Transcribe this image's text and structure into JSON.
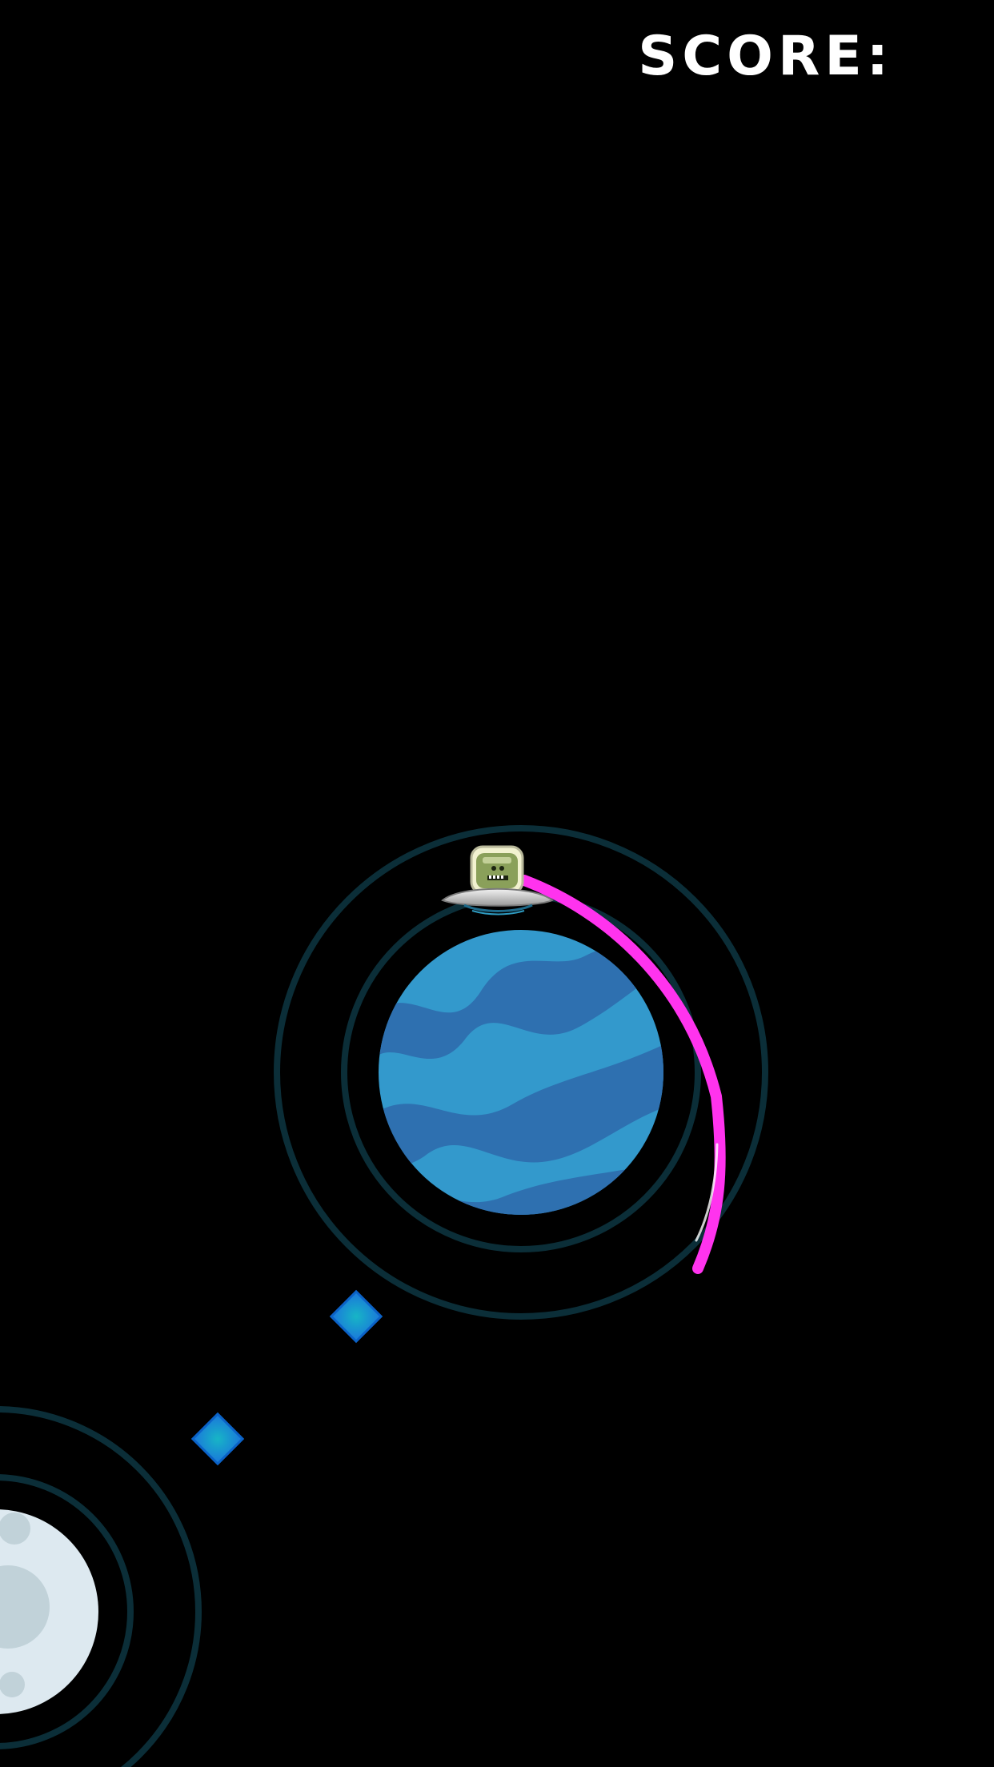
{
  "hud": {
    "score_label": "SCORE:"
  },
  "colors": {
    "background": "#000000",
    "orbit_ring": "#0b2e38",
    "planet_light": "#3399cc",
    "planet_dark": "#2e70b0",
    "trail": "#ff33ee",
    "gem": "#1890d8",
    "gem_core": "#17b5c6",
    "moon": "#dde9f0",
    "moon_crater": "#c1d2d9",
    "alien": "#8aa05a",
    "ufo_saucer": "#c9c9c9"
  },
  "sprites": {
    "player": "ufo-alien-icon",
    "home_planet": "blue-striped-planet",
    "next_planet": "moon-planet",
    "pickup": "diamond-gem-icon"
  }
}
